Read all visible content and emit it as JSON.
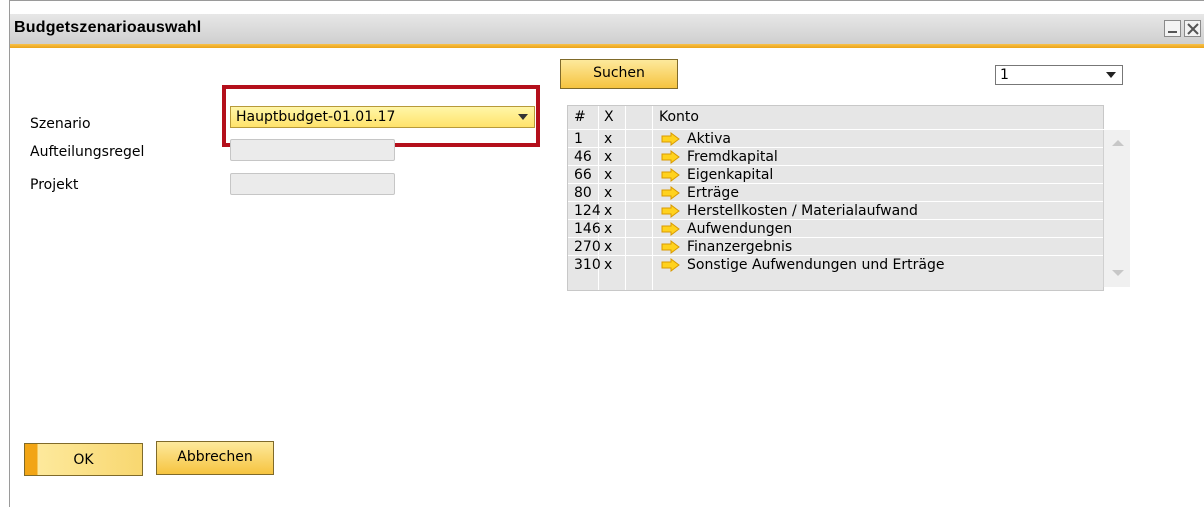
{
  "window": {
    "title": "Budgetszenarioauswahl"
  },
  "form": {
    "szenario_label": "Szenario",
    "szenario_value": "Hauptbudget-01.01.17",
    "aufteilungsregel_label": "Aufteilungsregel",
    "aufteilungsregel_value": "",
    "projekt_label": "Projekt",
    "projekt_value": ""
  },
  "search": {
    "button_label": "Suchen",
    "level_value": "1"
  },
  "grid": {
    "headers": [
      "#",
      "X",
      "Konto"
    ],
    "rows": [
      {
        "num": "1",
        "x": "x",
        "konto": "Aktiva"
      },
      {
        "num": "46",
        "x": "x",
        "konto": "Fremdkapital"
      },
      {
        "num": "66",
        "x": "x",
        "konto": "Eigenkapital"
      },
      {
        "num": "80",
        "x": "x",
        "konto": "Erträge"
      },
      {
        "num": "124",
        "x": "x",
        "konto": "Herstellkosten / Materialaufwand"
      },
      {
        "num": "146",
        "x": "x",
        "konto": "Aufwendungen"
      },
      {
        "num": "270",
        "x": "x",
        "konto": "Finanzergebnis"
      },
      {
        "num": "310",
        "x": "x",
        "konto": "Sonstige Aufwendungen und Erträge"
      }
    ],
    "row_icon": "yellow-arrow-icon"
  },
  "buttons": {
    "ok_label": "OK",
    "cancel_label": "Abbrechen"
  },
  "colors": {
    "accent": "#f6c440",
    "highlight_frame": "#b40f1b",
    "title_bar_line": "#eaa31a"
  }
}
